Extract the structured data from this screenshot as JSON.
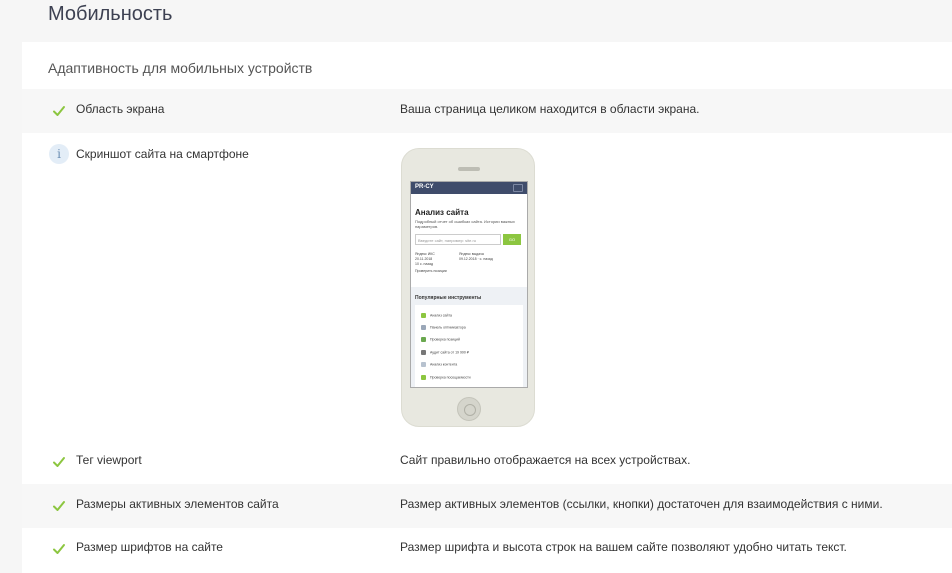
{
  "page": {
    "title": "Мобильность"
  },
  "section": {
    "title": "Адаптивность для мобильных устройств"
  },
  "checks": [
    {
      "label": "Область экрана",
      "value": "Ваша страница целиком находится в области экрана.",
      "status": "ok"
    },
    {
      "label": "Тег viewport",
      "value": "Сайт правильно отображается на всех устройствах.",
      "status": "ok"
    },
    {
      "label": "Размеры активных элементов сайта",
      "value": "Размер активных элементов (ссылки, кнопки) достаточен для взаимодействия с ними.",
      "status": "ok"
    },
    {
      "label": "Размер шрифтов на сайте",
      "value": "Размер шрифта и высота строк на вашем сайте позволяют удобно читать текст.",
      "status": "ok"
    }
  ],
  "screenshot": {
    "label": "Скриншот сайта на смартфоне",
    "site": {
      "logo": "PR-CY",
      "title": "Анализ сайта",
      "subtitle": "Подробный отчет об ошибках сайта. Истории важных параметров.",
      "input_placeholder": "Введите сайт, например: site.ru",
      "go_label": "GO",
      "stat1": "Яндекс ИКС\n20.11.2018\n10 с. назад",
      "stat2": "Яндекс выдача\n09.12.2018 · с. назад",
      "check_positions": "Проверить позиции",
      "popular_title": "Популярные инструменты",
      "tools": [
        {
          "label": "Анализ сайта",
          "color": "#8cc640"
        },
        {
          "label": "Панель оптимизатора",
          "color": "#9aa7b8"
        },
        {
          "label": "Проверка позиций",
          "color": "#6aa84f"
        },
        {
          "label": "Аудит сайта от 19 990 ₽",
          "color": "#777777"
        },
        {
          "label": "Анализ контента",
          "color": "#b7c2cf"
        },
        {
          "label": "Проверка посещаемости",
          "color": "#8cc640"
        }
      ]
    }
  },
  "colors": {
    "check": "#8cc640",
    "info_bg": "#e3edf7",
    "info_fg": "#6a8db3"
  }
}
